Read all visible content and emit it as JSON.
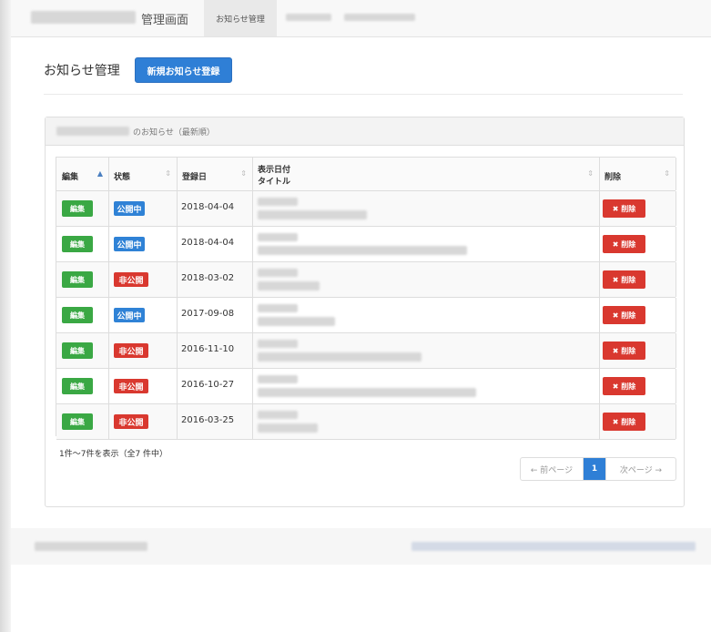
{
  "navbar": {
    "brand": "管理画面",
    "active_tab": "お知らせ管理"
  },
  "header": {
    "title": "お知らせ管理",
    "new_button": "新規お知らせ登録"
  },
  "panel": {
    "heading_suffix": "のお知らせ（最新順）"
  },
  "table": {
    "columns": {
      "edit": "編集",
      "status": "状態",
      "registered": "登録日",
      "display_date": "表示日付",
      "title": "タイトル",
      "delete": "削除"
    },
    "sort_icons": {
      "asc": "▲",
      "both": "⇕"
    },
    "rows": [
      {
        "edit": "編集",
        "status": "公開中",
        "status_kind": "published",
        "registered": "2018-04-04",
        "delete": "✖ 削除"
      },
      {
        "edit": "編集",
        "status": "公開中",
        "status_kind": "published",
        "registered": "2018-04-04",
        "delete": "✖ 削除"
      },
      {
        "edit": "編集",
        "status": "非公開",
        "status_kind": "unpublished",
        "registered": "2018-03-02",
        "delete": "✖ 削除"
      },
      {
        "edit": "編集",
        "status": "公開中",
        "status_kind": "published",
        "registered": "2017-09-08",
        "delete": "✖ 削除"
      },
      {
        "edit": "編集",
        "status": "非公開",
        "status_kind": "unpublished",
        "registered": "2016-11-10",
        "delete": "✖ 削除"
      },
      {
        "edit": "編集",
        "status": "非公開",
        "status_kind": "unpublished",
        "registered": "2016-10-27",
        "delete": "✖ 削除"
      },
      {
        "edit": "編集",
        "status": "非公開",
        "status_kind": "unpublished",
        "registered": "2016-03-25",
        "delete": "✖ 削除"
      }
    ]
  },
  "summary": "1件〜7件を表示（全7 件中）",
  "pagination": {
    "prev": "← 前ページ",
    "current": "1",
    "next": "次ページ →"
  },
  "colors": {
    "primary": "#2f7fd6",
    "success": "#3aa844",
    "danger": "#d9382f"
  }
}
